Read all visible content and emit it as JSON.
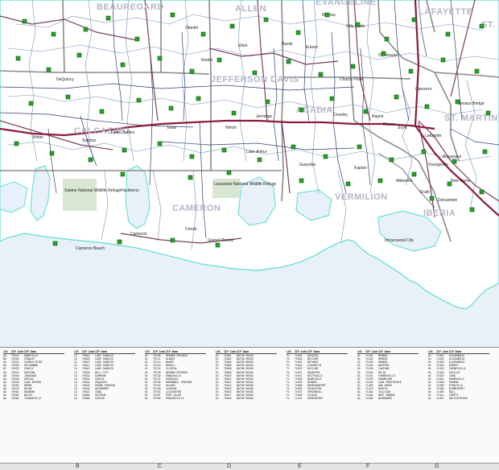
{
  "map": {
    "parish_labels": [
      "BEAUREGARD",
      "ALLEN",
      "EVANGELINE",
      "LAFAYETTE",
      "JEFFERSON DAVIS",
      "CALCASIEU",
      "ACADIA",
      "ST. MARTIN",
      "CAMERON",
      "VERMILION",
      "IBERIA",
      "ST. LANDRY"
    ],
    "place_labels": [
      "Lake Charles",
      "Sulphur",
      "Vinton",
      "Jennings",
      "Crowley",
      "Lafayette",
      "Rayne",
      "Iowa",
      "Welsh",
      "Lake Arthur",
      "Kaplan",
      "Abbeville",
      "New Iberia",
      "Broussard",
      "Youngsville",
      "Cameron",
      "Hackberry",
      "Creole",
      "Grand Chenier",
      "Gueydan",
      "Erath",
      "Delcambre",
      "Breaux Bridge",
      "Carencro",
      "Scott",
      "Duson",
      "Church Point",
      "Eunice",
      "Opelousas",
      "DeQuincy",
      "Oberlin",
      "Kinder",
      "Elton",
      "Basile",
      "Mamou",
      "Ville Platte",
      "Sabine National Wildlife Refuge",
      "Lacassine National Wildlife Refuge",
      "Intracoastal City",
      "Cameron Beach"
    ],
    "colors": {
      "water": "#e8f1fa",
      "land": "#ffffff",
      "coast": "#6fe0d2",
      "parish_line": "#8a8a8a",
      "interstate": "#8b1c3a",
      "highway": "#7a3f5a",
      "road": "#2c3e6e",
      "zip_boundary": "#6e8fb4",
      "zip_marker": "#27a327",
      "park": "#d8e6d2"
    }
  },
  "index": {
    "headers": [
      "LOC",
      "ZIP Code",
      "ZIP Name"
    ],
    "columns": [
      {
        "rows": [
          [
            "A6",
            "70510",
            "ABBEVILLE"
          ],
          [
            "B6",
            "70526",
            "CROWLEY"
          ],
          [
            "A5",
            "70525",
            "CHURCH POINT"
          ],
          [
            "A6",
            "70528",
            "DELCAMBRE"
          ],
          [
            "B7",
            "70535",
            "EUNICE"
          ],
          [
            "A6",
            "70542",
            "GUEYDAN"
          ],
          [
            "A6",
            "70546",
            "JENNINGS"
          ],
          [
            "A6",
            "70548",
            "KAPLAN"
          ],
          [
            "A6",
            "70549",
            "LAKE ARTHUR"
          ],
          [
            "A6",
            "70559",
            "MORSE"
          ],
          [
            "A6",
            "70578",
            "RAYNE"
          ],
          [
            "A6",
            "70581",
            "ROANOKE"
          ],
          [
            "A6",
            "70591",
            "WELSH"
          ],
          [
            "A6",
            "70592",
            "YOUNGSVILLE"
          ]
        ]
      },
      {
        "rows": [
          [
            "C2",
            "70601",
            "LAKE CHARLES"
          ],
          [
            "C2",
            "70605",
            "LAKE CHARLES"
          ],
          [
            "C2",
            "70607",
            "LAKE CHARLES"
          ],
          [
            "C2",
            "70611",
            "LAKE CHARLES"
          ],
          [
            "C2",
            "70615",
            "LAKE CHARLES"
          ],
          [
            "C4",
            "70630",
            "BELL CITY"
          ],
          [
            "C4",
            "70631",
            "CAMERON"
          ],
          [
            "C4",
            "70632",
            "CREOLE"
          ],
          [
            "C2",
            "70633",
            "DEQUINCY"
          ],
          [
            "C4",
            "70643",
            "GRAND CHENIER"
          ],
          [
            "C3",
            "70645",
            "HACKBERRY"
          ],
          [
            "C3",
            "70647",
            "IOWA"
          ],
          [
            "C2",
            "70663",
            "SULPHUR"
          ],
          [
            "C2",
            "70668",
            "VINTON"
          ]
        ]
      },
      {
        "rows": [
          [
            "D1",
            "70706",
            "DENHAM SPRINGS"
          ],
          [
            "D1",
            "70711",
            "ALBANY"
          ],
          [
            "D1",
            "70714",
            "BAKER"
          ],
          [
            "D1",
            "70719",
            "BRUSLY"
          ],
          [
            "D1",
            "70722",
            "CLINTON"
          ],
          [
            "D1",
            "70726",
            "DENHAM SPRINGS"
          ],
          [
            "D1",
            "70729",
            "ERWINVILLE"
          ],
          [
            "D1",
            "70737",
            "GONZALES"
          ],
          [
            "D1",
            "70739",
            "GREENWELL SPRINGS"
          ],
          [
            "D1",
            "70744",
            "HOLDEN"
          ],
          [
            "D1",
            "70748",
            "JACKSON"
          ],
          [
            "D1",
            "70754",
            "LIVINGSTON"
          ],
          [
            "D1",
            "70767",
            "PORT ALLEN"
          ],
          [
            "D1",
            "70769",
            "PRAIRIEVILLE"
          ]
        ]
      },
      {
        "rows": [
          [
            "E1",
            "70801",
            "BATON ROUGE"
          ],
          [
            "E1",
            "70802",
            "BATON ROUGE"
          ],
          [
            "E1",
            "70805",
            "BATON ROUGE"
          ],
          [
            "E1",
            "70806",
            "BATON ROUGE"
          ],
          [
            "E1",
            "70808",
            "BATON ROUGE"
          ],
          [
            "E1",
            "70809",
            "BATON ROUGE"
          ],
          [
            "E1",
            "70810",
            "BATON ROUGE"
          ],
          [
            "E1",
            "70811",
            "BATON ROUGE"
          ],
          [
            "E1",
            "70812",
            "BATON ROUGE"
          ],
          [
            "E1",
            "70814",
            "BATON ROUGE"
          ],
          [
            "E1",
            "70815",
            "BATON ROUGE"
          ],
          [
            "E1",
            "70816",
            "BATON ROUGE"
          ],
          [
            "E1",
            "70817",
            "BATON ROUGE"
          ],
          [
            "E1",
            "70820",
            "BATON ROUGE"
          ]
        ]
      },
      {
        "rows": [
          [
            "F1",
            "71001",
            "ARCADIA"
          ],
          [
            "F1",
            "71004",
            "BELCHER"
          ],
          [
            "F1",
            "71007",
            "BETHANY"
          ],
          [
            "F1",
            "71019",
            "COUSHATTA"
          ],
          [
            "F1",
            "71023",
            "DOYLINE"
          ],
          [
            "F1",
            "71037",
            "HAUGHTON"
          ],
          [
            "F1",
            "71047",
            "KEITHVILLE"
          ],
          [
            "F1",
            "71052",
            "MANSFIELD"
          ],
          [
            "F1",
            "71055",
            "MINDEN"
          ],
          [
            "F1",
            "71060",
            "MOORINGSPORT"
          ],
          [
            "F1",
            "71067",
            "PRINCETON"
          ],
          [
            "F1",
            "71075",
            "SPRINGHILL"
          ],
          [
            "F1",
            "71082",
            "VIVIAN"
          ],
          [
            "F1",
            "71101",
            "SHREVEPORT"
          ]
        ]
      },
      {
        "rows": [
          [
            "G1",
            "71201",
            "MONROE"
          ],
          [
            "G1",
            "71202",
            "MONROE"
          ],
          [
            "G1",
            "71203",
            "MONROE"
          ],
          [
            "G1",
            "71220",
            "BASTROP"
          ],
          [
            "G1",
            "71226",
            "CHATHAM"
          ],
          [
            "G1",
            "71232",
            "DELHI"
          ],
          [
            "G1",
            "71241",
            "FARMERVILLE"
          ],
          [
            "G1",
            "71245",
            "GRAMBLING"
          ],
          [
            "G1",
            "71254",
            "LAKE PROVIDENCE"
          ],
          [
            "G1",
            "71263",
            "OAK GROVE"
          ],
          [
            "G1",
            "71270",
            "RUSTON"
          ],
          [
            "G1",
            "71282",
            "TALLULAH"
          ],
          [
            "G1",
            "71291",
            "WEST MONROE"
          ],
          [
            "G1",
            "71295",
            "WINNSBORO"
          ]
        ]
      },
      {
        "rows": [
          [
            "H1",
            "71301",
            "ALEXANDRIA"
          ],
          [
            "H1",
            "71302",
            "ALEXANDRIA"
          ],
          [
            "H1",
            "71303",
            "ALEXANDRIA"
          ],
          [
            "H1",
            "71322",
            "BUNKIE"
          ],
          [
            "H1",
            "71325",
            "CHENEYVILLE"
          ],
          [
            "H1",
            "71328",
            "DEVILLE"
          ],
          [
            "H1",
            "71342",
            "JENA"
          ],
          [
            "H1",
            "71351",
            "MARKSVILLE"
          ],
          [
            "H1",
            "71356",
            "MORROW"
          ],
          [
            "H1",
            "71360",
            "PINEVILLE"
          ],
          [
            "H1",
            "71369",
            "SIMMESPORT"
          ],
          [
            "H1",
            "71405",
            "BALL"
          ],
          [
            "H1",
            "71411",
            "CAMPTI"
          ],
          [
            "H1",
            "71457",
            "NATCHITOCHES"
          ]
        ]
      }
    ],
    "grid_letters": [
      "B",
      "C",
      "D",
      "E",
      "F",
      "G"
    ]
  }
}
